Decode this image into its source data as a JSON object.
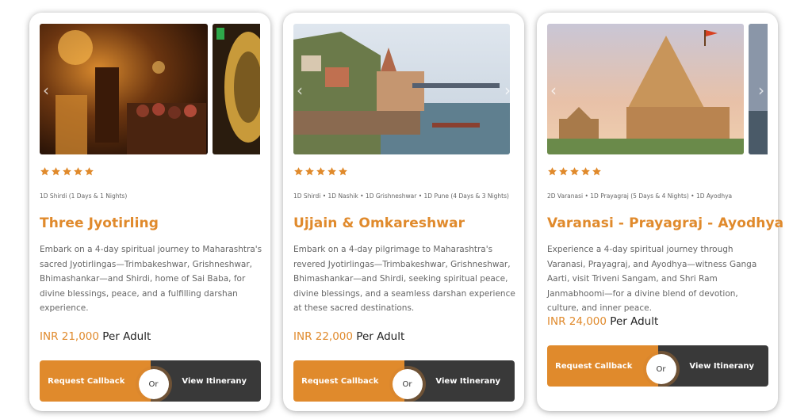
{
  "cards": [
    {
      "rating": 5,
      "route": "1D Shirdi (1 Days & 1 Nights)",
      "title": "Three Jyotirling",
      "description": "Embark on a 4-day spiritual journey to Maharashtra's sacred Jyotirlingas—Trimbakeshwar, Grishneshwar, Bhimashankar—and Shirdi, home of Sai Baba, for divine blessings, peace, and a fulfilling darshan experience.",
      "price_amount": "INR 21,000",
      "price_unit": "Per Adult",
      "callback_label": "Request Callback",
      "or_label": "Or",
      "itinerary_label": "View Itinerany"
    },
    {
      "rating": 5,
      "route": "1D Shirdi • 1D Nashik • 1D Grishneshwar • 1D Pune  (4 Days & 3 Nights)",
      "title": "Ujjain & Omkareshwar",
      "description": "Embark on a 4-day pilgrimage to Maharashtra's revered Jyotirlingas—Trimbakeshwar, Grishneshwar, Bhimashankar—and Shirdi, seeking spiritual peace, divine blessings, and a seamless darshan experience at these sacred destinations.",
      "price_amount": "INR 22,000",
      "price_unit": "Per Adult",
      "callback_label": "Request Callback",
      "or_label": "Or",
      "itinerary_label": "View Itinerany"
    },
    {
      "rating": 5,
      "route": "2D Varanasi • 1D Prayagraj  (5 Days & 4 Nights) • 1D Ayodhya",
      "title": "Varanasi - Prayagraj - Ayodhya",
      "description": "Experience a 4-day spiritual journey through Varanasi, Prayagraj, and Ayodhya—witness Ganga Aarti, visit Triveni Sangam, and Shri Ram Janmabhoomi—for a divine blend of devotion, culture, and inner peace.",
      "price_amount": "INR 24,000",
      "price_unit": "Per Adult",
      "callback_label": "Request Callback",
      "or_label": "Or",
      "itinerary_label": "View Itinerany"
    }
  ],
  "icons": {
    "star": "star-icon",
    "prev": "chevron-left-icon",
    "next": "chevron-right-icon"
  },
  "colors": {
    "accent": "#e08a2c",
    "dark_button": "#393939"
  }
}
